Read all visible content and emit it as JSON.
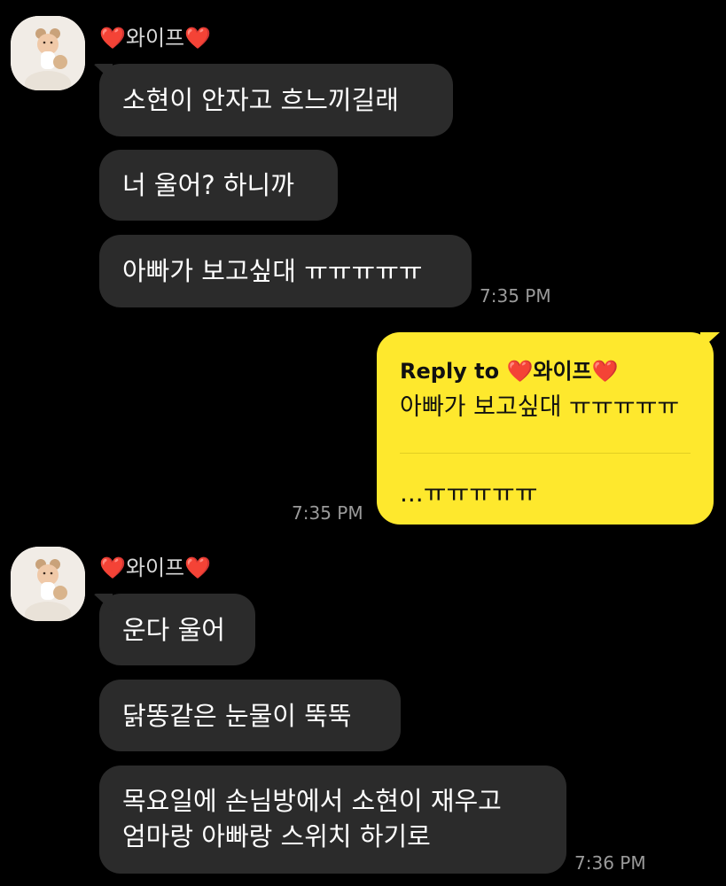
{
  "colors": {
    "background": "#000000",
    "incoming_bubble": "#2b2b2b",
    "outgoing_bubble": "#fee82d",
    "heart": "#f0476a",
    "timestamp": "#9a9a9a"
  },
  "sender_name": "❤️와이프❤️",
  "group1": {
    "messages": [
      "소현이 안자고 흐느끼길래",
      "너 울어? 하니까",
      "아빠가 보고싶대 ㅠㅠㅠㅠㅠ"
    ],
    "time": "7:35 PM"
  },
  "reply": {
    "label": "Reply to ❤️와이프❤️",
    "quoted": "아빠가 보고싶대 ㅠㅠㅠㅠㅠ",
    "body": "...ㅠㅠㅠㅠㅠ",
    "time": "7:35 PM"
  },
  "group2": {
    "messages": [
      "운다 울어",
      "닭똥같은 눈물이 뚝뚝"
    ],
    "multi_line": {
      "line1": "목요일에 손님방에서 소현이 재우고",
      "line2": "엄마랑 아빠랑 스위치 하기로"
    },
    "time": "7:36 PM"
  }
}
